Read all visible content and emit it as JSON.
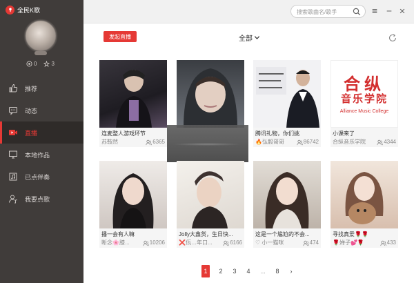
{
  "app": {
    "title": "全民K歌",
    "brand_color": "#e53935"
  },
  "profile": {
    "gifts": "0",
    "flowers": "3"
  },
  "nav": {
    "items": [
      {
        "id": "recommend",
        "label": "推荐",
        "icon": "thumbs-up-icon",
        "active": false
      },
      {
        "id": "feed",
        "label": "动态",
        "icon": "chat-bubble-icon",
        "active": false
      },
      {
        "id": "live",
        "label": "直播",
        "icon": "video-camera-icon",
        "active": true
      },
      {
        "id": "local",
        "label": "本地作品",
        "icon": "monitor-icon",
        "active": false
      },
      {
        "id": "downloaded",
        "label": "已点伴奏",
        "icon": "music-note-icon",
        "active": false
      },
      {
        "id": "request",
        "label": "我要点歌",
        "icon": "person-music-icon",
        "active": false
      }
    ]
  },
  "search": {
    "placeholder": "搜索歌曲名/歌手"
  },
  "toolbar": {
    "start_live": "发起直播",
    "filter": "全部"
  },
  "rooms": [
    {
      "title": "连麦整人游戏环节",
      "owner": "苏鞍然",
      "count": "6365",
      "colors": [
        "#2a2a2e",
        "#6b5e72"
      ]
    },
    {
      "title": "",
      "owner": "",
      "count": "",
      "colors": [
        "#2f3236",
        "#9aa0a6"
      ]
    },
    {
      "title": "腾讯礼物，你们挑",
      "owner": "弘毅哥哥",
      "count": "86742",
      "colors": [
        "#1c1f2a",
        "#e9e9ee"
      ]
    },
    {
      "title": "小课来了",
      "owner": "合纵音乐学院",
      "count": "4344",
      "colors": [
        "#ffffff",
        "#ffffff"
      ],
      "logo": {
        "cn1": "合纵",
        "cn2": "音乐学院",
        "en": "Alliance Music College"
      }
    },
    {
      "title": "播一会有人嘛",
      "owner": "断念🌸膝...",
      "count": "10206",
      "colors": [
        "#e6e2df",
        "#2a2626"
      ]
    },
    {
      "title": "Jolly大鑫货，生日快...",
      "owner": "❌佤…年口...",
      "count": "6166",
      "colors": [
        "#f0eee9",
        "#3b3330"
      ]
    },
    {
      "title": "这是一个尴尬的不会...",
      "owner": "♡ 小一猫咪",
      "count": "474",
      "colors": [
        "#d9d4cd",
        "#3a2d27"
      ]
    },
    {
      "title": "寻找真爱🌹🌹",
      "owner": "🌹婵子💕🌹",
      "count": "433",
      "colors": [
        "#e9d8cc",
        "#a8826c"
      ]
    }
  ],
  "pager": {
    "pages": [
      "1",
      "2",
      "3",
      "4",
      "...",
      "8"
    ],
    "current": "1",
    "next": "›"
  }
}
